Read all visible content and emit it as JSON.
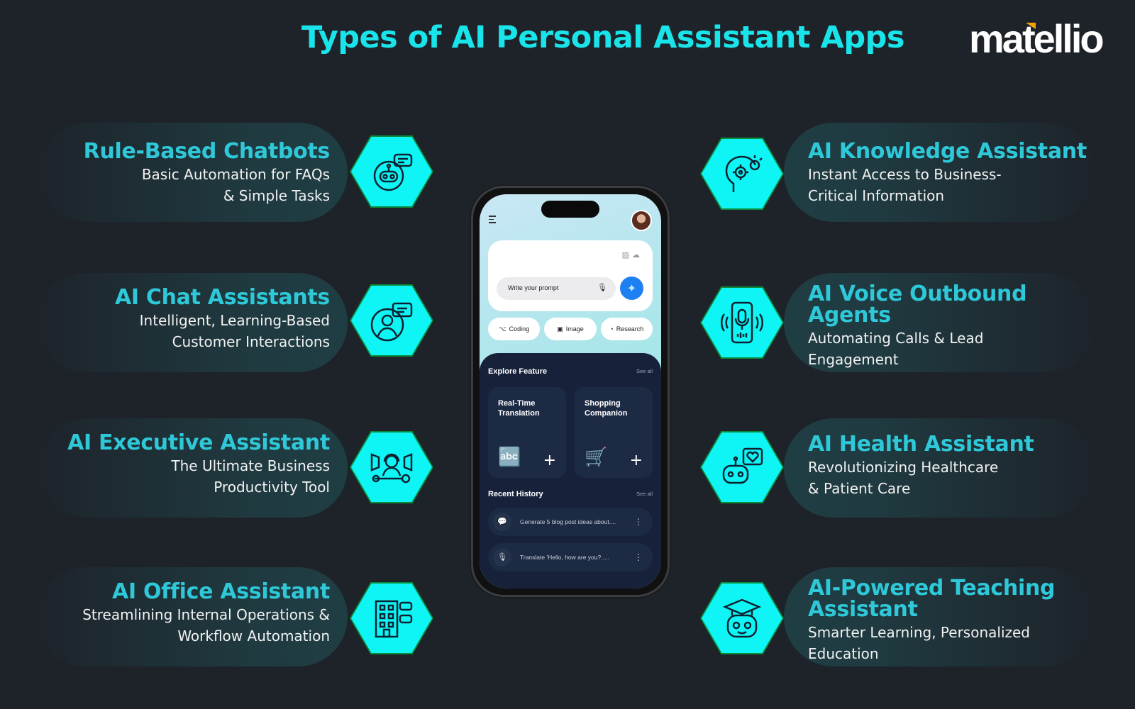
{
  "title": "Types of AI Personal Assistant Apps",
  "logo": {
    "text": "matellio",
    "accent_color": "#f5a300"
  },
  "colors": {
    "background": "#1e232a",
    "heading": "#2ec8d8",
    "title": "#19e4ea",
    "hex_fill": "#0ff5f5",
    "hex_border": "#0a8a3a"
  },
  "left_items": [
    {
      "heading": "Rule-Based Chatbots",
      "line1": "Basic Automation for FAQs",
      "line2": "& Simple Tasks",
      "icon": "robot-chat-icon"
    },
    {
      "heading": "AI Chat Assistants",
      "line1": "Intelligent, Learning-Based",
      "line2": "Customer Interactions",
      "icon": "user-chat-icon"
    },
    {
      "heading": "AI Executive Assistant",
      "line1": "The Ultimate Business",
      "line2": "Productivity Tool",
      "icon": "headset-wrench-icon"
    },
    {
      "heading": "AI Office Assistant",
      "line1": "Streamlining Internal Operations &",
      "line2": "Workflow Automation",
      "icon": "office-building-icon"
    }
  ],
  "right_items": [
    {
      "heading": "AI Knowledge Assistant",
      "heading2": "",
      "line1": "Instant Access to Business-",
      "line2": "Critical Information",
      "icon": "brain-gear-icon"
    },
    {
      "heading": "AI Voice Outbound",
      "heading2": "Agents",
      "line1": "Automating Calls & Lead",
      "line2": "Engagement",
      "icon": "phone-mic-icon"
    },
    {
      "heading": "AI Health Assistant",
      "heading2": "",
      "line1": "Revolutionizing Healthcare",
      "line2": "& Patient Care",
      "icon": "robot-health-icon"
    },
    {
      "heading": "AI-Powered Teaching",
      "heading2": "Assistant",
      "line1": "Smarter Learning, Personalized",
      "line2": "Education",
      "icon": "robot-graduation-icon"
    }
  ],
  "phone": {
    "prompt_placeholder": "Write your prompt",
    "chips": [
      {
        "label": "Coding",
        "icon": "⌥"
      },
      {
        "label": "Image",
        "icon": "▣"
      },
      {
        "label": "Research",
        "icon": "◔"
      }
    ],
    "explore_title": "Explore Feature",
    "see_all": "See all",
    "features": [
      {
        "title": "Real-Time Translation",
        "icon": "🔤"
      },
      {
        "title": "Shopping Companion",
        "icon": "🛒"
      }
    ],
    "history_title": "Recent History",
    "history": [
      {
        "text": "Generate 5 blog post ideas about....",
        "icon": "💬"
      },
      {
        "text": "Translate 'Hello, how are you?.....",
        "icon": "🎙"
      }
    ],
    "plus": "+",
    "more": "⋮",
    "spark": "✦"
  }
}
